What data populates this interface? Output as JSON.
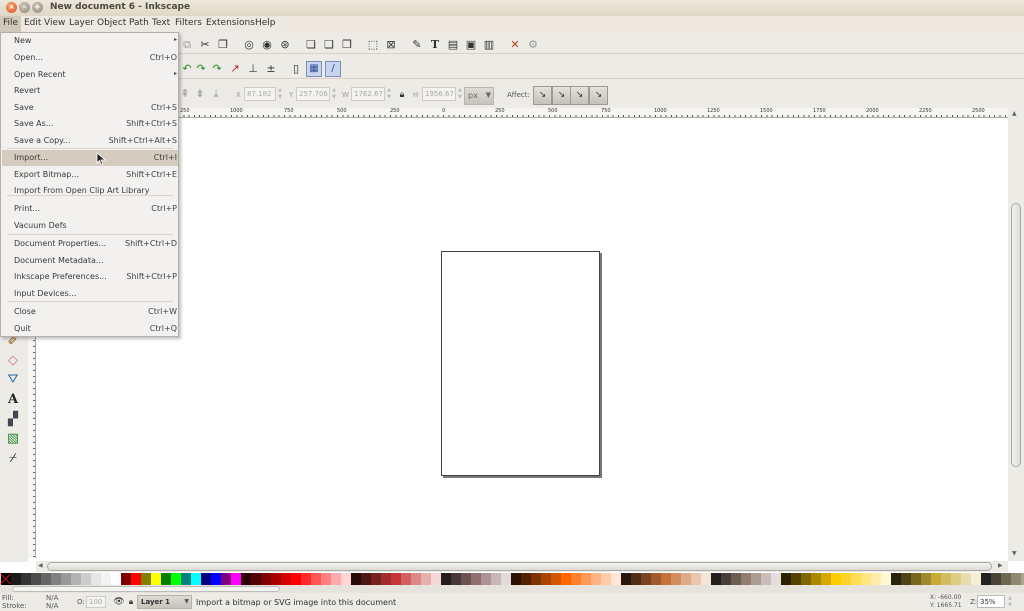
{
  "window": {
    "title": "New document 6 - Inkscape"
  },
  "menubar": [
    "File",
    "Edit",
    "View",
    "Layer",
    "Object",
    "Path",
    "Text",
    "Filters",
    "Extensions",
    "Help"
  ],
  "file_menu": [
    {
      "label": "New",
      "shortcut": "",
      "submenu": true
    },
    {
      "label": "Open...",
      "shortcut": "Ctrl+O"
    },
    {
      "label": "Open Recent",
      "shortcut": "",
      "submenu": true
    },
    {
      "label": "Revert",
      "shortcut": ""
    },
    {
      "label": "Save",
      "shortcut": "Ctrl+S"
    },
    {
      "label": "Save As...",
      "shortcut": "Shift+Ctrl+S"
    },
    {
      "label": "Save a Copy...",
      "shortcut": "Shift+Ctrl+Alt+S"
    },
    {
      "label": "Import...",
      "shortcut": "Ctrl+I",
      "highlighted": true
    },
    {
      "label": "Export Bitmap...",
      "shortcut": "Shift+Ctrl+E"
    },
    {
      "label": "Import From Open Clip Art Library",
      "shortcut": ""
    },
    {
      "label": "Print...",
      "shortcut": "Ctrl+P"
    },
    {
      "label": "Vacuum Defs",
      "shortcut": ""
    },
    {
      "label": "Document Properties...",
      "shortcut": "Shift+Ctrl+D"
    },
    {
      "label": "Document Metadata...",
      "shortcut": ""
    },
    {
      "label": "Inkscape Preferences...",
      "shortcut": "Shift+Ctrl+P"
    },
    {
      "label": "Input Devices...",
      "shortcut": ""
    },
    {
      "label": "Close",
      "shortcut": "Ctrl+W"
    },
    {
      "label": "Quit",
      "shortcut": "Ctrl+Q"
    }
  ],
  "tool_controls": {
    "x_label": "X",
    "x_value": "87.182",
    "y_label": "Y",
    "y_value": "257.706",
    "w_label": "W",
    "w_value": "1762.67",
    "h_label": "H",
    "h_value": "1956.67",
    "unit": "px",
    "affect_label": "Affect:"
  },
  "ruler_labels": [
    "250",
    "1000",
    "750",
    "500",
    "250",
    "0",
    "250",
    "500",
    "750",
    "1000",
    "1250",
    "1500",
    "1750",
    "2000",
    "2250",
    "2500"
  ],
  "statusbar": {
    "fill_label": "Fill:",
    "fill_value": "N/A",
    "stroke_label": "Stroke:",
    "stroke_value": "N/A",
    "opacity_label": "O:",
    "opacity_value": "100",
    "layer": "Layer 1",
    "message": "Import a bitmap or SVG image into this document",
    "cursor_x": "X: -660.00",
    "cursor_y": "Y: 1665.71",
    "zoom_label": "Z:",
    "zoom_value": "35%"
  },
  "palette": [
    "#000000",
    "#1a1a1a",
    "#333333",
    "#4d4d4d",
    "#666666",
    "#808080",
    "#999999",
    "#b3b3b3",
    "#cccccc",
    "#e6e6e6",
    "#f2f2f2",
    "#ffffff",
    "#800000",
    "#ff0000",
    "#808000",
    "#ffff00",
    "#008000",
    "#00ff00",
    "#008080",
    "#00ffff",
    "#000080",
    "#0000ff",
    "#800080",
    "#ff00ff",
    "#2b0000",
    "#550000",
    "#800000",
    "#aa0000",
    "#d40000",
    "#ff0000",
    "#ff2a2a",
    "#ff5555",
    "#ff8080",
    "#ffaaaa",
    "#ffd5d5",
    "#280b0b",
    "#501616",
    "#782121",
    "#a02c2c",
    "#c83737",
    "#d35f5f",
    "#de8787",
    "#e9afaf",
    "#f4d7d7",
    "#241c1c",
    "#483737",
    "#6c5353",
    "#916f6f",
    "#ac9393",
    "#c8b7b7",
    "#e3dbdb",
    "#2b1100",
    "#552200",
    "#803300",
    "#aa4400",
    "#d45500",
    "#ff6600",
    "#ff7f2a",
    "#ff9955",
    "#ffb380",
    "#ffccaa",
    "#ffe6d5",
    "#28170b",
    "#502d16",
    "#784421",
    "#a05a2c",
    "#c87137",
    "#d38d5f",
    "#deaa87",
    "#e9c6af",
    "#f4e3d7",
    "#241f1c",
    "#483e37",
    "#6c5d53",
    "#917c6f",
    "#ac9d93",
    "#c8beb7",
    "#e3dedb",
    "#2b2200",
    "#554400",
    "#806600",
    "#aa8800",
    "#d4aa00",
    "#ffcc00",
    "#ffd42a",
    "#ffdd55",
    "#ffe680",
    "#ffeeaa",
    "#fff6d5",
    "#28220b",
    "#504416",
    "#786721",
    "#a0892c",
    "#c8ab37",
    "#d3bc5f",
    "#decd87",
    "#e9ddaf",
    "#f4eed7",
    "#24221c",
    "#484537",
    "#6c6753",
    "#91896f",
    "#aca793",
    "#c8c4b7",
    "#e3e2db"
  ]
}
